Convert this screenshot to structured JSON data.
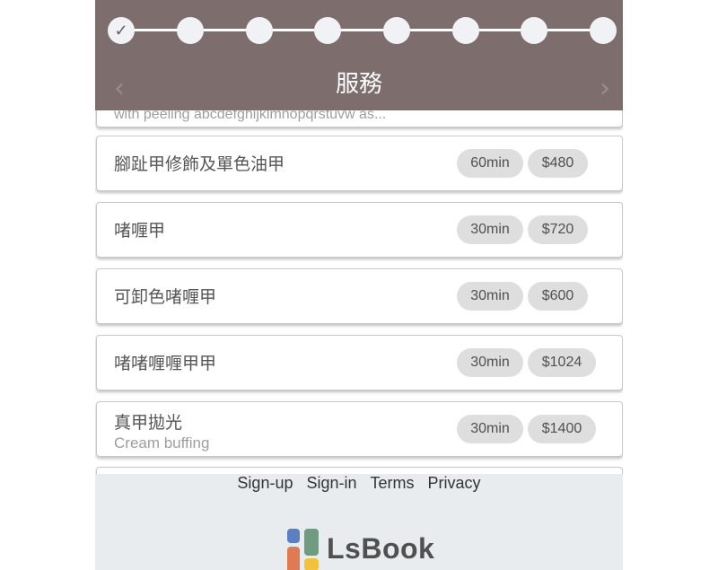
{
  "header": {
    "title": "服務",
    "steps": [
      {
        "label": "✓",
        "completed": true
      },
      {
        "label": "",
        "completed": false
      },
      {
        "label": "",
        "completed": false
      },
      {
        "label": "",
        "completed": false
      },
      {
        "label": "",
        "completed": false
      },
      {
        "label": "",
        "completed": false
      },
      {
        "label": "",
        "completed": false
      },
      {
        "label": "",
        "completed": false
      }
    ],
    "prev_icon": "‹",
    "next_icon": "›"
  },
  "services": {
    "partial_desc": "with peeling abcdefghijklmnopqrstuvw as...",
    "items": [
      {
        "name": "腳趾甲修飾及單色油甲",
        "desc": "",
        "duration": "60min",
        "price": "$480"
      },
      {
        "name": "啫喱甲",
        "desc": "",
        "duration": "30min",
        "price": "$720"
      },
      {
        "name": "可卸色啫喱甲",
        "desc": "",
        "duration": "30min",
        "price": "$600"
      },
      {
        "name": "啫啫喱喱甲甲",
        "desc": "",
        "duration": "30min",
        "price": "$1024"
      },
      {
        "name": "真甲拋光",
        "desc": "Cream buffing",
        "duration": "30min",
        "price": "$1400"
      }
    ]
  },
  "footer": {
    "links": [
      "Sign-up",
      "Sign-in",
      "Terms",
      "Privacy"
    ],
    "logo_text": "LsBook"
  },
  "colors": {
    "header_bg": "#7d6e6d",
    "footer_bg": "#e9ecef",
    "logo_blue": "#5b7fc0",
    "logo_green": "#6f9c80",
    "logo_orange": "#e07a52",
    "logo_yellow": "#f2c23c"
  }
}
